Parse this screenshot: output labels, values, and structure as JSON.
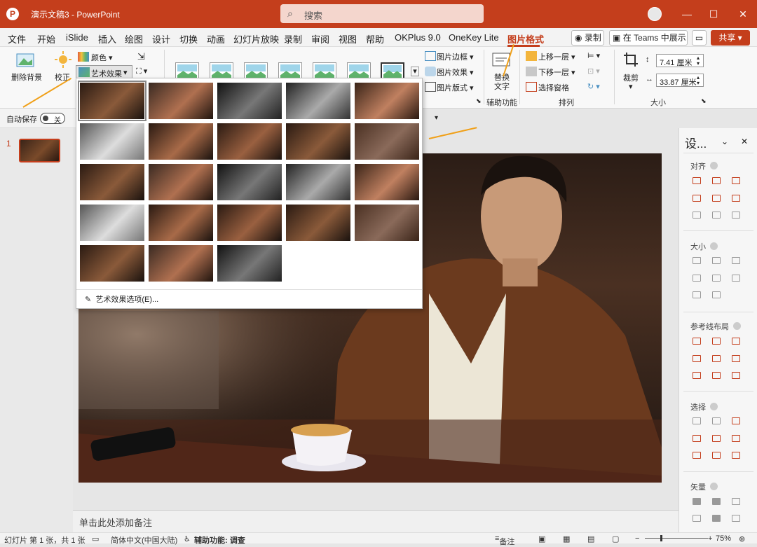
{
  "title_bar": {
    "doc_title": "演示文稿3 - PowerPoint",
    "search_placeholder": "搜索",
    "min_glyph": "—",
    "max_glyph": "☐",
    "close_glyph": "✕"
  },
  "menu": {
    "items": [
      "文件",
      "开始",
      "iSlide",
      "插入",
      "绘图",
      "设计",
      "切换",
      "动画",
      "幻灯片放映",
      "录制",
      "审阅",
      "视图",
      "帮助",
      "OKPlus 9.0",
      "OneKey Lite",
      "图片格式"
    ],
    "active": "图片格式",
    "record_label": "录制",
    "teams_label": "在 Teams 中展示",
    "share_label": "共享"
  },
  "ribbon": {
    "remove_bg": "删除背景",
    "correct": "校正",
    "color": "颜色",
    "artistic": "艺术效果",
    "picture_border": "图片边框",
    "picture_effects": "图片效果",
    "picture_layout": "图片版式",
    "alt_text_1": "替换",
    "alt_text_2": "文字",
    "accessibility_group": "辅助功能",
    "bring_forward": "上移一层",
    "send_backward": "下移一层",
    "selection_pane": "选择窗格",
    "arrange_group": "排列",
    "crop": "裁剪",
    "height": "7.41 厘米",
    "width": "33.87 厘米",
    "size_group": "大小"
  },
  "qat": {
    "autosave": "自动保存",
    "toggle": "关"
  },
  "slides": {
    "number": "1"
  },
  "notes": {
    "placeholder": "单击此处添加备注"
  },
  "artistic_dropdown": {
    "rows": [
      5,
      5,
      5,
      5,
      3
    ],
    "selected_index": 0,
    "options_label": "艺术效果选项(E)..."
  },
  "right_panel": {
    "title": "设...",
    "sections": [
      "对齐",
      "大小",
      "参考线布局",
      "选择",
      "矢量"
    ]
  },
  "status": {
    "slide": "幻灯片 第 1 张，共 1 张",
    "language": "简体中文(中国大陆)",
    "accessibility": "辅助功能: 调查",
    "notes": "备注",
    "zoom": "75%"
  },
  "colors": {
    "accent": "#c43e1c",
    "arrow": "#f0a019"
  }
}
